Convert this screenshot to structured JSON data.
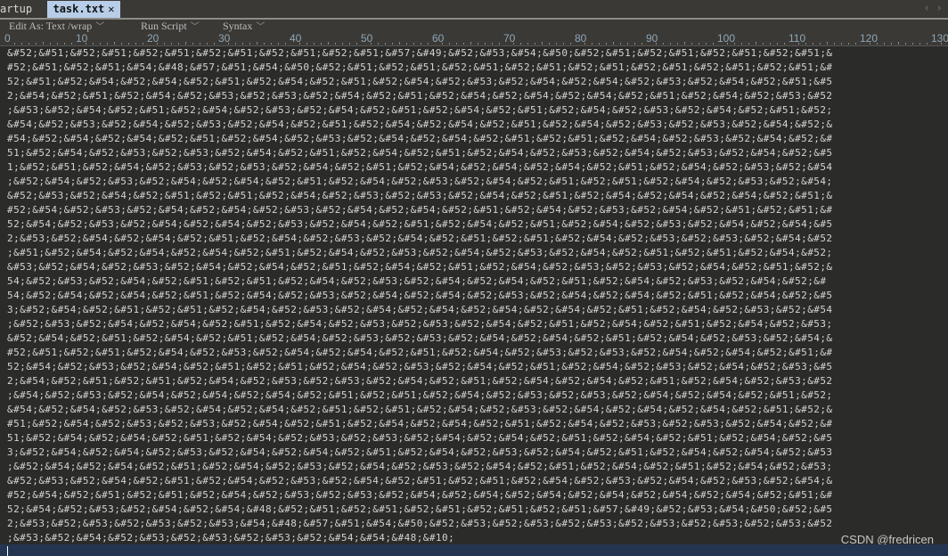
{
  "tabs": [
    {
      "label": "artup",
      "active": false
    },
    {
      "label": "task.txt",
      "active": true,
      "close_glyph": "✕"
    }
  ],
  "nav": {
    "prev": "‹",
    "next": "›"
  },
  "toolbar": {
    "edit_as": "Edit As: Text /wrap",
    "run_script": "Run Script",
    "syntax": "Syntax",
    "chevron": "﹀"
  },
  "ruler": {
    "labels": [
      "0",
      "10",
      "20",
      "30",
      "40",
      "50",
      "60",
      "70",
      "80",
      "90",
      "100",
      "110",
      "120",
      "130"
    ]
  },
  "editor": {
    "lines": [
      "&#52;&#51;&#52;&#51;&#52;&#51;&#52;&#51;&#52;&#51;&#52;&#51;&#57;&#49;&#52;&#53;&#54;&#50;&#52;&#51;&#52;&#51;&#52;&#51;&#52;&#51;&",
      "#52;&#51;&#52;&#51;&#54;&#48;&#57;&#51;&#54;&#50;&#52;&#51;&#52;&#51;&#52;&#51;&#52;&#51;&#52;&#51;&#52;&#51;&#52;&#51;&#52;&#51;&#",
      "52;&#51;&#52;&#54;&#52;&#54;&#52;&#51;&#52;&#54;&#52;&#51;&#52;&#54;&#52;&#53;&#52;&#54;&#52;&#54;&#52;&#53;&#52;&#54;&#52;&#51;&#5",
      "2;&#54;&#52;&#51;&#52;&#54;&#52;&#53;&#52;&#53;&#52;&#54;&#52;&#51;&#52;&#54;&#52;&#54;&#52;&#54;&#52;&#51;&#52;&#54;&#52;&#53;&#52",
      ";&#53;&#52;&#54;&#52;&#51;&#52;&#54;&#52;&#53;&#52;&#54;&#52;&#51;&#52;&#54;&#52;&#51;&#52;&#54;&#52;&#53;&#52;&#54;&#52;&#51;&#52;",
      "&#54;&#52;&#53;&#52;&#54;&#52;&#53;&#52;&#54;&#52;&#51;&#52;&#54;&#52;&#54;&#52;&#51;&#52;&#54;&#52;&#53;&#52;&#53;&#52;&#54;&#52;&",
      "#54;&#52;&#54;&#52;&#54;&#52;&#51;&#52;&#54;&#52;&#53;&#52;&#54;&#52;&#54;&#52;&#51;&#52;&#51;&#52;&#54;&#52;&#53;&#52;&#54;&#52;&#",
      "51;&#52;&#54;&#52;&#53;&#52;&#53;&#52;&#54;&#52;&#51;&#52;&#54;&#52;&#51;&#52;&#54;&#52;&#53;&#52;&#54;&#52;&#53;&#52;&#54;&#52;&#5",
      "1;&#52;&#51;&#52;&#54;&#52;&#53;&#52;&#53;&#52;&#54;&#52;&#51;&#52;&#54;&#52;&#54;&#52;&#54;&#52;&#51;&#52;&#54;&#52;&#53;&#52;&#54",
      ";&#52;&#54;&#52;&#53;&#52;&#54;&#52;&#54;&#52;&#51;&#52;&#54;&#52;&#53;&#52;&#54;&#52;&#51;&#52;&#51;&#52;&#54;&#52;&#53;&#52;&#54;",
      "&#52;&#53;&#52;&#54;&#52;&#51;&#52;&#51;&#52;&#54;&#52;&#53;&#52;&#53;&#52;&#54;&#52;&#51;&#52;&#54;&#52;&#54;&#52;&#54;&#52;&#51;&",
      "#52;&#54;&#52;&#53;&#52;&#54;&#52;&#54;&#52;&#53;&#52;&#54;&#52;&#54;&#52;&#51;&#52;&#54;&#52;&#53;&#52;&#54;&#52;&#51;&#52;&#51;&#",
      "52;&#54;&#52;&#53;&#52;&#54;&#52;&#54;&#52;&#53;&#52;&#54;&#52;&#51;&#52;&#54;&#52;&#51;&#52;&#54;&#52;&#53;&#52;&#54;&#52;&#54;&#5",
      "2;&#53;&#52;&#54;&#52;&#54;&#52;&#51;&#52;&#54;&#52;&#53;&#52;&#54;&#52;&#51;&#52;&#51;&#52;&#54;&#52;&#53;&#52;&#53;&#52;&#54;&#52",
      ";&#51;&#52;&#54;&#52;&#54;&#52;&#54;&#52;&#51;&#52;&#54;&#52;&#53;&#52;&#54;&#52;&#53;&#52;&#54;&#52;&#51;&#52;&#51;&#52;&#54;&#52;",
      "&#53;&#52;&#54;&#52;&#53;&#52;&#54;&#52;&#54;&#52;&#51;&#52;&#54;&#52;&#51;&#52;&#54;&#52;&#53;&#52;&#53;&#52;&#54;&#52;&#51;&#52;&",
      "54;&#52;&#53;&#52;&#54;&#52;&#51;&#52;&#51;&#52;&#54;&#52;&#53;&#52;&#54;&#52;&#54;&#52;&#51;&#52;&#54;&#52;&#53;&#52;&#54;&#52;&#",
      "54;&#52;&#54;&#52;&#54;&#52;&#51;&#52;&#54;&#52;&#53;&#52;&#54;&#52;&#54;&#52;&#53;&#52;&#54;&#52;&#54;&#52;&#51;&#52;&#54;&#52;&#5",
      "3;&#52;&#54;&#52;&#51;&#52;&#51;&#52;&#54;&#52;&#53;&#52;&#54;&#52;&#54;&#52;&#54;&#52;&#54;&#52;&#51;&#52;&#54;&#52;&#53;&#52;&#54",
      ";&#52;&#53;&#52;&#54;&#52;&#54;&#52;&#51;&#52;&#54;&#52;&#53;&#52;&#53;&#52;&#54;&#52;&#51;&#52;&#54;&#52;&#51;&#52;&#54;&#52;&#53;",
      "&#52;&#54;&#52;&#51;&#52;&#54;&#52;&#51;&#52;&#54;&#52;&#53;&#52;&#53;&#52;&#54;&#52;&#54;&#52;&#51;&#52;&#54;&#52;&#53;&#52;&#54;&",
      "#52;&#51;&#52;&#51;&#52;&#54;&#52;&#53;&#52;&#54;&#52;&#54;&#52;&#51;&#52;&#54;&#52;&#53;&#52;&#53;&#52;&#54;&#52;&#54;&#52;&#51;&#",
      "52;&#54;&#52;&#53;&#52;&#54;&#52;&#51;&#52;&#51;&#52;&#54;&#52;&#53;&#52;&#54;&#52;&#51;&#52;&#54;&#52;&#53;&#52;&#54;&#52;&#53;&#5",
      "2;&#54;&#52;&#51;&#52;&#51;&#52;&#54;&#52;&#53;&#52;&#53;&#52;&#54;&#52;&#51;&#52;&#54;&#52;&#54;&#52;&#51;&#52;&#54;&#52;&#53;&#52",
      ";&#54;&#52;&#53;&#52;&#54;&#52;&#54;&#52;&#54;&#52;&#51;&#52;&#51;&#52;&#54;&#52;&#53;&#52;&#53;&#52;&#54;&#52;&#54;&#52;&#51;&#52;",
      "&#54;&#52;&#54;&#52;&#53;&#52;&#54;&#52;&#54;&#52;&#51;&#52;&#51;&#52;&#54;&#52;&#53;&#52;&#54;&#52;&#54;&#52;&#54;&#52;&#51;&#52;&",
      "#51;&#52;&#54;&#52;&#53;&#52;&#53;&#52;&#54;&#52;&#51;&#52;&#54;&#52;&#54;&#52;&#51;&#52;&#54;&#52;&#53;&#52;&#53;&#52;&#54;&#52;&#",
      "51;&#52;&#54;&#52;&#54;&#52;&#51;&#52;&#54;&#52;&#53;&#52;&#53;&#52;&#54;&#52;&#54;&#52;&#51;&#52;&#54;&#52;&#51;&#52;&#54;&#52;&#5",
      "3;&#52;&#54;&#52;&#54;&#52;&#53;&#52;&#54;&#52;&#54;&#52;&#51;&#52;&#54;&#52;&#53;&#52;&#54;&#52;&#51;&#52;&#54;&#52;&#54;&#52;&#53",
      ";&#52;&#54;&#52;&#54;&#52;&#51;&#52;&#54;&#52;&#53;&#52;&#54;&#52;&#53;&#52;&#54;&#52;&#51;&#52;&#54;&#52;&#51;&#52;&#54;&#52;&#53;",
      "&#52;&#53;&#52;&#54;&#52;&#51;&#52;&#54;&#52;&#53;&#52;&#54;&#52;&#51;&#52;&#51;&#52;&#54;&#52;&#53;&#52;&#54;&#52;&#53;&#52;&#54;&",
      "#52;&#54;&#52;&#51;&#52;&#51;&#52;&#54;&#52;&#53;&#52;&#53;&#52;&#54;&#52;&#54;&#52;&#54;&#52;&#54;&#52;&#54;&#52;&#54;&#52;&#51;&#",
      "52;&#54;&#52;&#53;&#52;&#54;&#52;&#54;&#48;&#52;&#51;&#52;&#51;&#52;&#51;&#52;&#51;&#52;&#51;&#57;&#49;&#52;&#53;&#54;&#50;&#52;&#5",
      "2;&#53;&#52;&#53;&#52;&#53;&#52;&#53;&#54;&#48;&#57;&#51;&#54;&#50;&#52;&#53;&#52;&#53;&#52;&#53;&#52;&#53;&#52;&#53;&#52;&#53;&#52",
      ";&#53;&#52;&#54;&#52;&#53;&#52;&#53;&#52;&#53;&#52;&#54;&#54;&#48;&#10;"
    ]
  },
  "watermark": "CSDN @fredricen",
  "colors": {
    "editor_bg": "#2b2b29",
    "text": "#d4d4d4",
    "active_tab_bg": "#b7cde8",
    "statusbar_bg": "#243551",
    "ruler_numbers": "#8fa6b8"
  }
}
